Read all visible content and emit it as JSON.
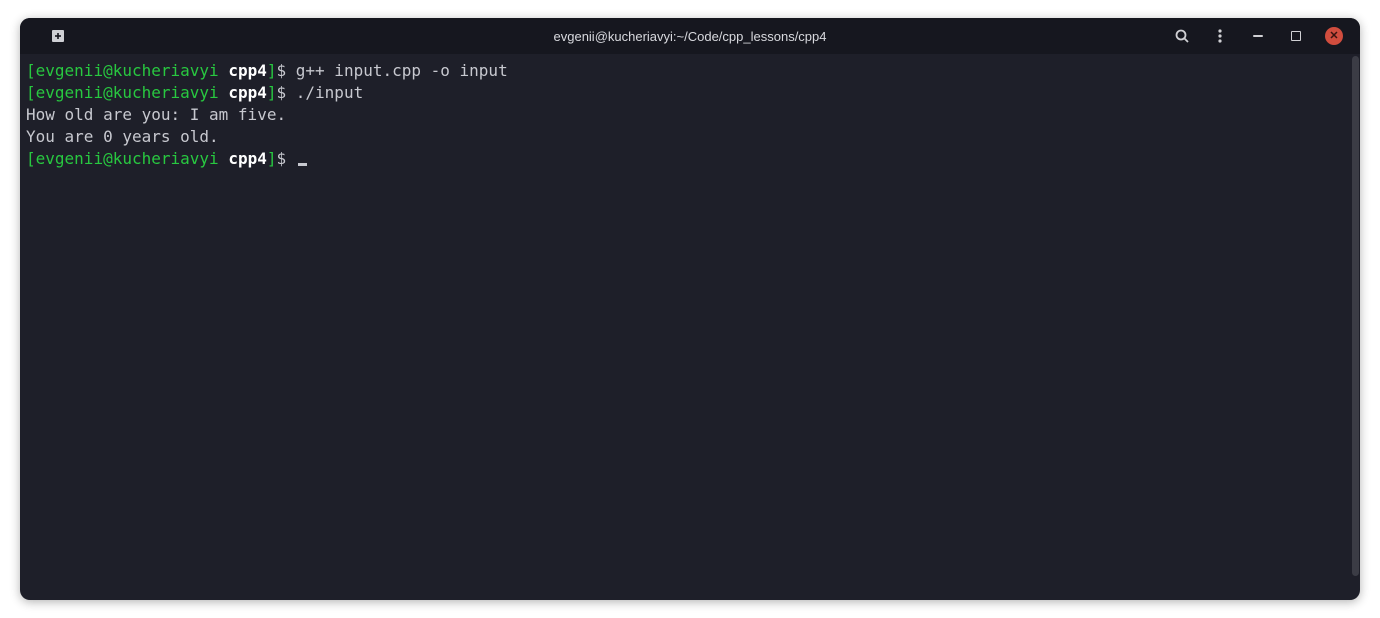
{
  "window": {
    "title": "evgenii@kucheriavyi:~/Code/cpp_lessons/cpp4"
  },
  "prompt": {
    "open_bracket": "[",
    "user": "evgenii",
    "at": "@",
    "host": "kucheriavyi",
    "space": " ",
    "dir": "cpp4",
    "close_bracket": "]",
    "dollar": "$"
  },
  "lines": [
    {
      "type": "prompt",
      "command": "g++ input.cpp -o input"
    },
    {
      "type": "prompt",
      "command": "./input"
    },
    {
      "type": "output",
      "text": "How old are you: I am five."
    },
    {
      "type": "output",
      "text": "You are 0 years old."
    },
    {
      "type": "prompt",
      "command": "",
      "cursor": true
    }
  ],
  "icons": {
    "new_tab": "new-tab",
    "search": "search",
    "menu": "menu",
    "minimize": "minimize",
    "maximize": "maximize",
    "close": "close"
  }
}
